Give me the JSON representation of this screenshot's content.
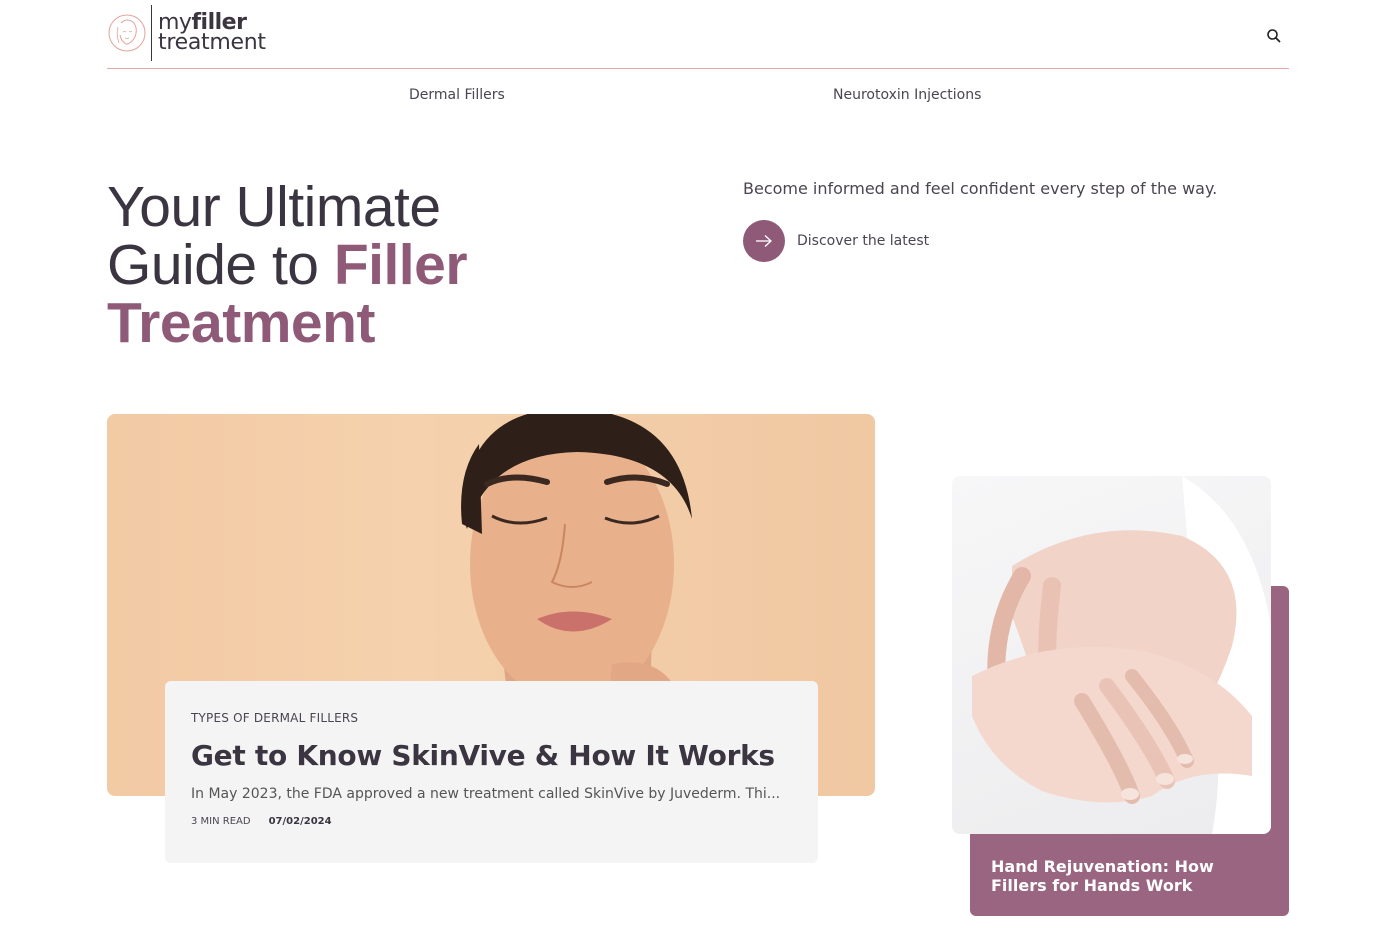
{
  "header": {
    "logo_line1_light": "my",
    "logo_line1_bold": "filler",
    "logo_line2": "treatment"
  },
  "nav": {
    "items": [
      {
        "label": "Dermal Fillers"
      },
      {
        "label": "Neurotoxin Injections"
      }
    ]
  },
  "hero": {
    "title_part1": "Your Ultimate",
    "title_part2": "Guide to ",
    "title_accent1": "Filler",
    "title_accent2": "Treatment",
    "subtitle": "Become informed and feel confident every step of the way.",
    "cta_label": "Discover the latest"
  },
  "feature": {
    "category": "TYPES OF DERMAL FILLERS",
    "title": "Get to Know SkinVive & How It Works",
    "excerpt": "In May 2023, the FDA approved a new treatment called SkinVive by Juvederm. Thi...",
    "read_time": "3 MIN READ",
    "date": "07/02/2024"
  },
  "side": {
    "title": "Hand Rejuvenation: How Fillers for Hands Work"
  },
  "colors": {
    "accent": "#8e5a78",
    "side_card": "#9a6581",
    "header_rule": "#e8a8a8"
  }
}
